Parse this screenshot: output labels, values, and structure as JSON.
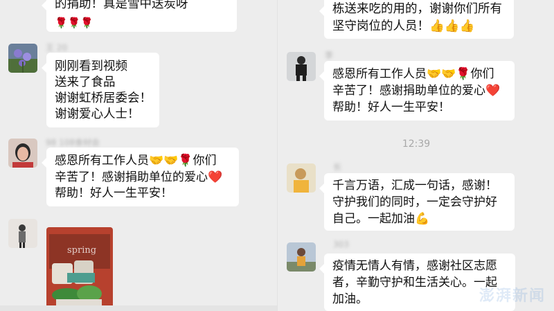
{
  "left": {
    "messages": [
      {
        "lines": [
          "的捐助！真是雪中送炭呀"
        ],
        "emoji_line": "🌹🌹🌹",
        "sender": ""
      },
      {
        "sender": "王 20",
        "lines": [
          "刚刚看到视频",
          "送来了食品",
          "谢谢虹桥居委会！",
          "谢谢爱心人士！"
        ]
      },
      {
        "sender": "98 108食材会",
        "lines": [
          "感恩所有工作人员🤝🤝🌹你们",
          "辛苦了！感谢捐助单位的爱心❤️",
          " 帮助！好人一生平安！"
        ]
      },
      {
        "sender": "",
        "photo_text": "spring"
      }
    ]
  },
  "right": {
    "messages": [
      {
        "lines": [
          "栋送来吃的用的，谢谢你们所有",
          "坚守岗位的人员！👍👍👍"
        ]
      },
      {
        "sender": "李",
        "lines": [
          "感恩所有工作人员🤝🤝🌹你们",
          "辛苦了！感谢捐助单位的爱心❤️",
          " 帮助！好人一生平安！"
        ]
      },
      {
        "sender": "长",
        "lines": [
          "千言万语，汇成一句话，感谢！",
          "守护我们的同时，一定会守护好",
          "自己。一起加油💪"
        ]
      },
      {
        "sender": "303",
        "lines": [
          "疫情无情人有情，感谢社区志愿",
          "者，辛勤守护和生活关心。一起",
          "加油。"
        ]
      }
    ],
    "timestamp": "12:39",
    "watermark": "澎湃新闻"
  }
}
